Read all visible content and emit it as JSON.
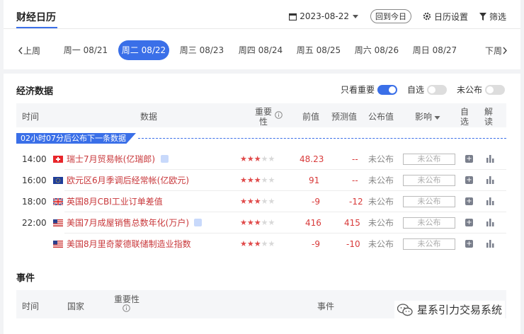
{
  "header": {
    "title": "财经日历",
    "date": "2023-08-22",
    "today_label": "回到今日",
    "settings_label": "日历设置",
    "filter_label": "筛选"
  },
  "week": {
    "prev_label": "上周",
    "next_label": "下周",
    "days": [
      {
        "label": "周一 08/21",
        "active": false
      },
      {
        "label": "周二 08/22",
        "active": true
      },
      {
        "label": "周三 08/23",
        "active": false
      },
      {
        "label": "周四 08/24",
        "active": false
      },
      {
        "label": "周五 08/25",
        "active": false
      },
      {
        "label": "周六 08/26",
        "active": false
      },
      {
        "label": "周日 08/27",
        "active": false
      }
    ]
  },
  "economic": {
    "title": "经济数据",
    "toggles": [
      {
        "label": "只看重要",
        "on": true
      },
      {
        "label": "自选",
        "on": false
      },
      {
        "label": "未公布",
        "on": false
      }
    ],
    "columns": {
      "time": "时间",
      "data": "数据",
      "importance_1": "重要",
      "importance_2": "性",
      "previous": "前值",
      "forecast": "预测值",
      "actual": "公布值",
      "impact": "影响",
      "watch_1": "自",
      "watch_2": "选",
      "analysis_1": "解",
      "analysis_2": "读"
    },
    "banner": "02小时07分后公布下一条数据",
    "rows": [
      {
        "time": "14:00",
        "flag": "ch",
        "name": "瑞士7月贸易帐(亿瑞郎)",
        "stars": 3,
        "previous": "48.23",
        "forecast": "--",
        "actual": "未公布",
        "impact": "未公布",
        "tag": true
      },
      {
        "time": "16:00",
        "flag": "eu",
        "name": "欧元区6月季调后经常帐(亿欧元)",
        "stars": 3,
        "previous": "91",
        "forecast": "--",
        "actual": "未公布",
        "impact": "未公布",
        "tag": false
      },
      {
        "time": "18:00",
        "flag": "uk",
        "name": "英国8月CBI工业订单差值",
        "stars": 3,
        "previous": "-9",
        "forecast": "-12",
        "actual": "未公布",
        "impact": "未公布",
        "tag": false
      },
      {
        "time": "22:00",
        "flag": "us",
        "name": "美国7月成屋销售总数年化(万户)",
        "stars": 3,
        "previous": "416",
        "forecast": "415",
        "actual": "未公布",
        "impact": "未公布",
        "tag": true
      },
      {
        "time": "",
        "flag": "us",
        "name": "美国8月里奇蒙德联储制造业指数",
        "stars": 3,
        "previous": "-9",
        "forecast": "-10",
        "actual": "未公布",
        "impact": "未公布",
        "tag": false
      }
    ]
  },
  "events": {
    "title": "事件",
    "columns": {
      "time": "时间",
      "country": "国家",
      "importance": "重要性",
      "event": "事件"
    }
  },
  "watermark": "星系引力交易系统",
  "colors": {
    "accent": "#3a6fe8",
    "name_red": "#c8373a",
    "star_red": "#e04a4a"
  }
}
